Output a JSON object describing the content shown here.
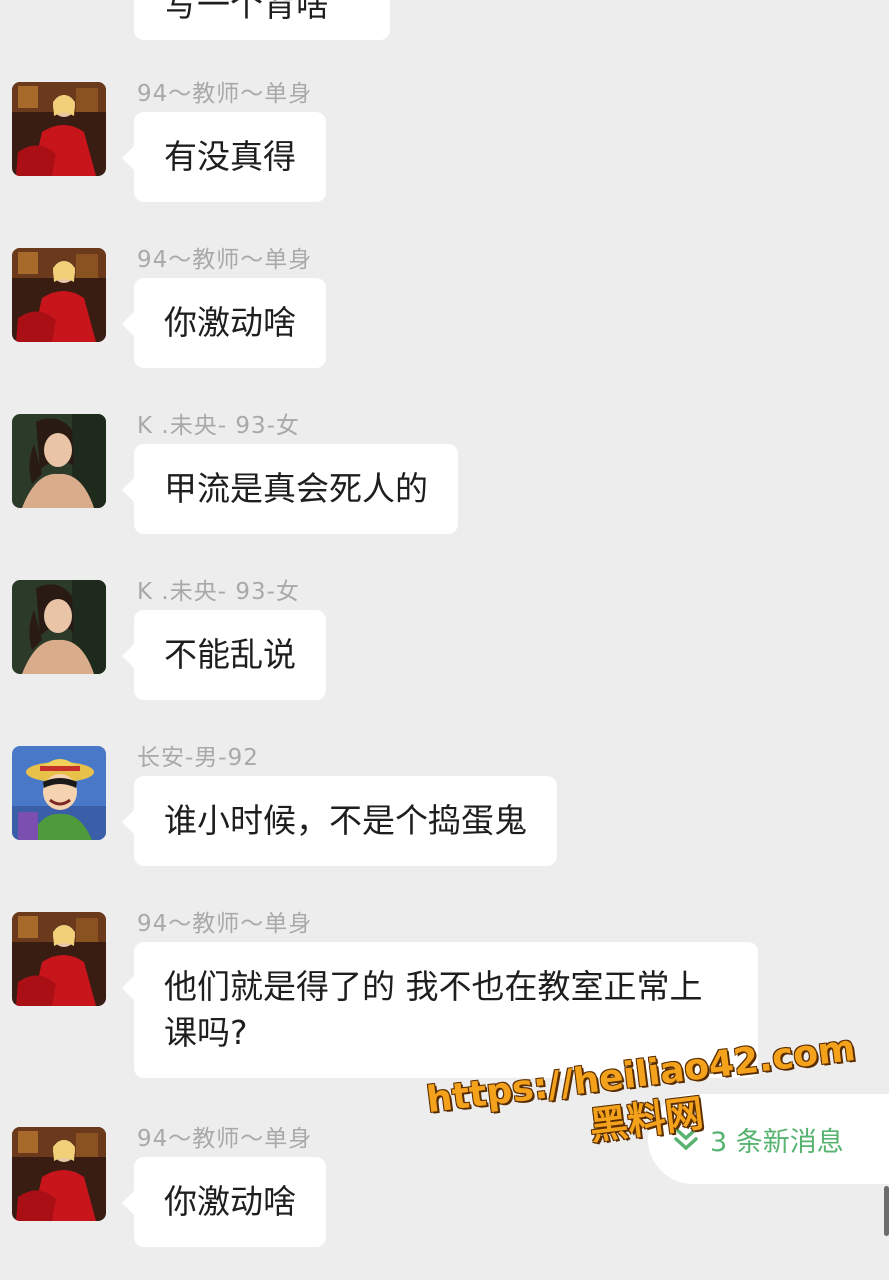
{
  "chat": {
    "partial_top_message": "写一个背啥",
    "messages": [
      {
        "sender": "94～教师～单身",
        "avatar": "red-dress-woman-avatar",
        "text": "有没真得"
      },
      {
        "sender": "94～教师～单身",
        "avatar": "red-dress-woman-avatar",
        "text": "你激动啥"
      },
      {
        "sender": "K .未央- 93-女",
        "avatar": "woman-portrait-avatar",
        "text": "甲流是真会死人的"
      },
      {
        "sender": "K .未央- 93-女",
        "avatar": "woman-portrait-avatar",
        "text": "不能乱说"
      },
      {
        "sender": "长安-男-92",
        "avatar": "cartoon-straw-hat-boy-avatar",
        "text": "谁小时候，不是个捣蛋鬼"
      },
      {
        "sender": "94～教师～单身",
        "avatar": "red-dress-woman-avatar",
        "text": "他们就是得了的 我不也在教室正常上课吗?"
      },
      {
        "sender": "94～教师～单身",
        "avatar": "red-dress-woman-avatar",
        "text": "你激动啥"
      }
    ]
  },
  "new_messages_pill": {
    "label": "3 条新消息",
    "icon": "double-chevron-down-icon",
    "color": "#57b36f"
  },
  "watermark": {
    "url": "https://heiliao42.com",
    "name": "黑料网",
    "color": "#f4a21c"
  },
  "colors": {
    "background": "#ededed",
    "bubble": "#ffffff",
    "sender_text": "#a9a9a9",
    "message_text": "#1e1e1e"
  }
}
